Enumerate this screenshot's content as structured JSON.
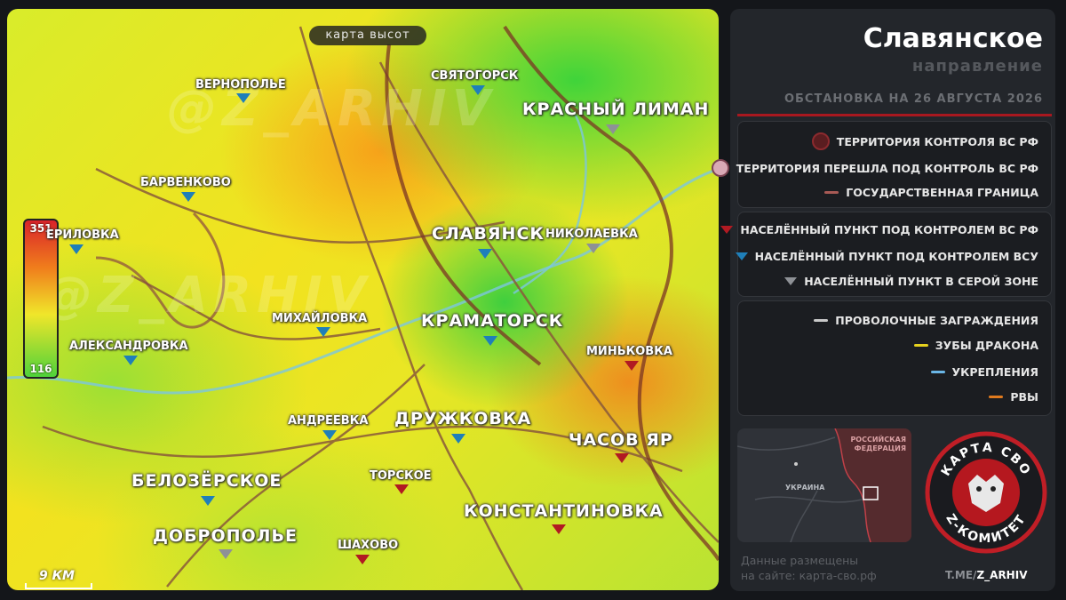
{
  "map": {
    "title": "карта высот",
    "watermark": "@Z_ARHIV",
    "scale_label": "9 КМ",
    "elevation_max": "351",
    "elevation_min": "116"
  },
  "cities": {
    "krasny_liman": "КРАСНЫЙ ЛИМАН",
    "svyatogorsk": "СВЯТОГОРСК",
    "vernopole": "ВЕРНОПОЛЬЕ",
    "barvenkovo": "БАРВЕНКОВО",
    "berilovka": "ЕРИЛОВКА",
    "slavyansk": "СЛАВЯНСК",
    "nikolaevka": "НИКОЛАЕВКА",
    "kramatorsk": "КРАМАТОРСК",
    "mikhaylovka": "МИХАЙЛОВКА",
    "aleksandrovka": "АЛЕКСАНДРОВКА",
    "minkovka": "МИНЬКОВКА",
    "andreevka": "АНДРЕЕВКА",
    "druzhkovka": "ДРУЖКОВКА",
    "chasov_yar": "ЧАСОВ ЯР",
    "belozerskoe": "БЕЛОЗЁРСКОЕ",
    "torskoe": "ТОРСКОЕ",
    "konstantinovka": "КОНСТАНТИНОВКА",
    "dobropole": "ДОБРОПОЛЬЕ",
    "shakhovo": "ШАХОВО"
  },
  "panel": {
    "title": "Славянское",
    "subtitle": "направление",
    "date": "ОБСТАНОВКА НА 26 АВГУСТА 2026"
  },
  "legend": {
    "territory_rf": "ТЕРРИТОРИЯ КОНТРОЛЯ ВС РФ",
    "territory_new": "ТЕРРИТОРИЯ ПЕРЕШЛА ПОД КОНТРОЛЬ ВС РФ",
    "border": "ГОСУДАРСТВЕННАЯ ГРАНИЦА",
    "town_rf": "НАСЕЛЁННЫЙ ПУНКТ ПОД КОНТРОЛЕМ ВС РФ",
    "town_ua": "НАСЕЛЁННЫЙ ПУНКТ ПОД КОНТРОЛЕМ ВСУ",
    "town_gray": "НАСЕЛЁННЫЙ ПУНКТ В СЕРОЙ ЗОНЕ",
    "wire": "ПРОВОЛОЧНЫЕ ЗАГРАЖДЕНИЯ",
    "dragon_teeth": "ЗУБЫ ДРАКОНА",
    "fortifications": "УКРЕПЛЕНИЯ",
    "ditches": "РВЫ"
  },
  "minimap": {
    "russia_label_1": "РОССИЙСКАЯ",
    "russia_label_2": "ФЕДЕРАЦИЯ",
    "ukraine_label": "УКРАИНА"
  },
  "emblem": {
    "top_text": "КАРТА СВО",
    "bottom_text": "Z-КОМИТЕТ"
  },
  "footer": {
    "site_line1": "Данные размещены",
    "site_line2": "на сайте: карта-сво.рф",
    "tg_prefix": "T.ME/",
    "tg_handle": "Z_ARHIV"
  },
  "colors": {
    "rf_control": "#b11a22",
    "ua_control": "#1f7fb9",
    "gray_zone": "#8e9196",
    "accent_line": "#a8181f",
    "wire": "#c9c9c9",
    "dragon_teeth": "#e6d21e",
    "fortifications": "#6ab6e6",
    "ditches": "#e07a1e"
  }
}
